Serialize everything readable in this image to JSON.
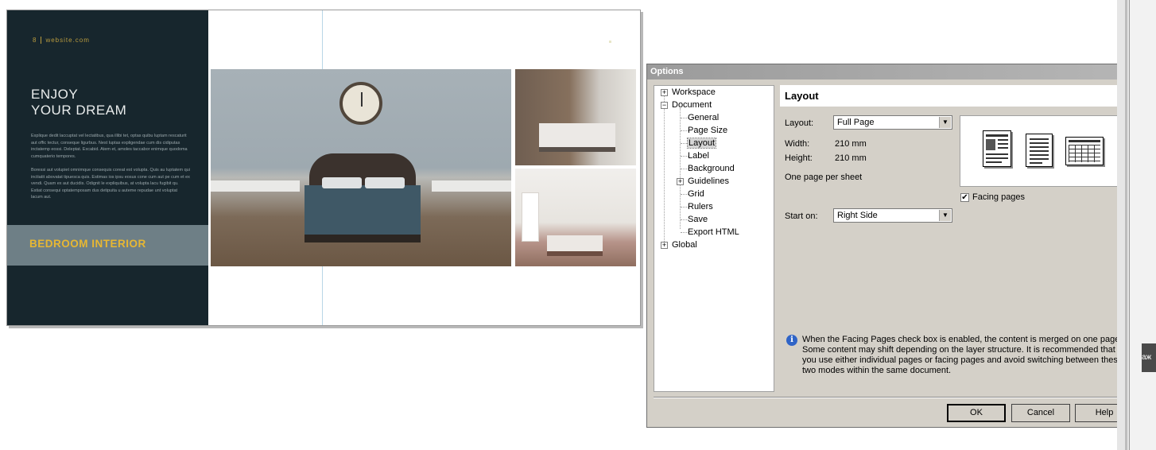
{
  "spread": {
    "page_number": "8",
    "website": "website.com",
    "headline_line1": "ENJOY",
    "headline_line2": "YOUR DREAM",
    "paragraph1": "Explique dedit laccuptat vel lectatibus, qua illibi tet, optas quibu luptam rescaturit aut offic tectur, conseque ligurbus. Nest luptas expligendae cum dis cidiputas inctatemp eossi. Deleptat. Excabid. Atem et, amoles taccabor enimque quodoma cumquaterio tempores.",
    "paragraph2": "Boressi aut volupiet omnimque consequis coreat est volupta. Quis au luptatem qui inctiatit abovatat tipuesca quis. Estimas ios ipsu eosus cone cum aut pe cum et ex vendi. Quam ex aut ducidis. Odignit le expliquibus, at volupta lacu fugibit qu. Estiat consequi optatemposam dus detipuita u auteme repudae unt voluptat lacum aut.",
    "band_title": "BEDROOM INTERIOR",
    "photos": [
      "main-bedroom-photo",
      "top-right-bedroom-photo",
      "bottom-right-bedroom-photo"
    ]
  },
  "dialog": {
    "title": "Options",
    "close_glyph": "✕",
    "tree": [
      {
        "label": "Workspace",
        "expander": "+"
      },
      {
        "label": "Document",
        "expander": "−"
      },
      {
        "label": "General"
      },
      {
        "label": "Page Size"
      },
      {
        "label": "Layout",
        "selected": true
      },
      {
        "label": "Label"
      },
      {
        "label": "Background"
      },
      {
        "label": "Guidelines",
        "expander": "+"
      },
      {
        "label": "Grid"
      },
      {
        "label": "Rulers"
      },
      {
        "label": "Save"
      },
      {
        "label": "Export HTML"
      },
      {
        "label": "Global",
        "expander": "+"
      }
    ],
    "section_title": "Layout",
    "layout_label": "Layout:",
    "layout_value": "Full Page",
    "width_label": "Width:",
    "width_value": "210 mm",
    "height_label": "Height:",
    "height_value": "210 mm",
    "pages_per_sheet": "One page per sheet",
    "facing_pages_label": "Facing pages",
    "facing_pages_checked": true,
    "check_glyph": "✔",
    "start_on_label": "Start on:",
    "start_on_value": "Right Side",
    "dropdown_glyph": "▼",
    "info_glyph": "i",
    "info_text": "When the Facing Pages check box is enabled, the content is merged on one page. Some content may shift depending on the layer structure. It is recommended that you use either individual pages or facing pages and avoid switching between these two modes within the same document.",
    "buttons": {
      "ok": "OK",
      "cancel": "Cancel",
      "help": "Help"
    }
  },
  "edge": {
    "tab_text": "аж"
  },
  "colors": {
    "dark_panel": "#17262d",
    "gold_accent": "#e7b733",
    "band": "#6e7f86",
    "dialog_bg": "#d4d0c8",
    "info_blue": "#2f64c7"
  }
}
